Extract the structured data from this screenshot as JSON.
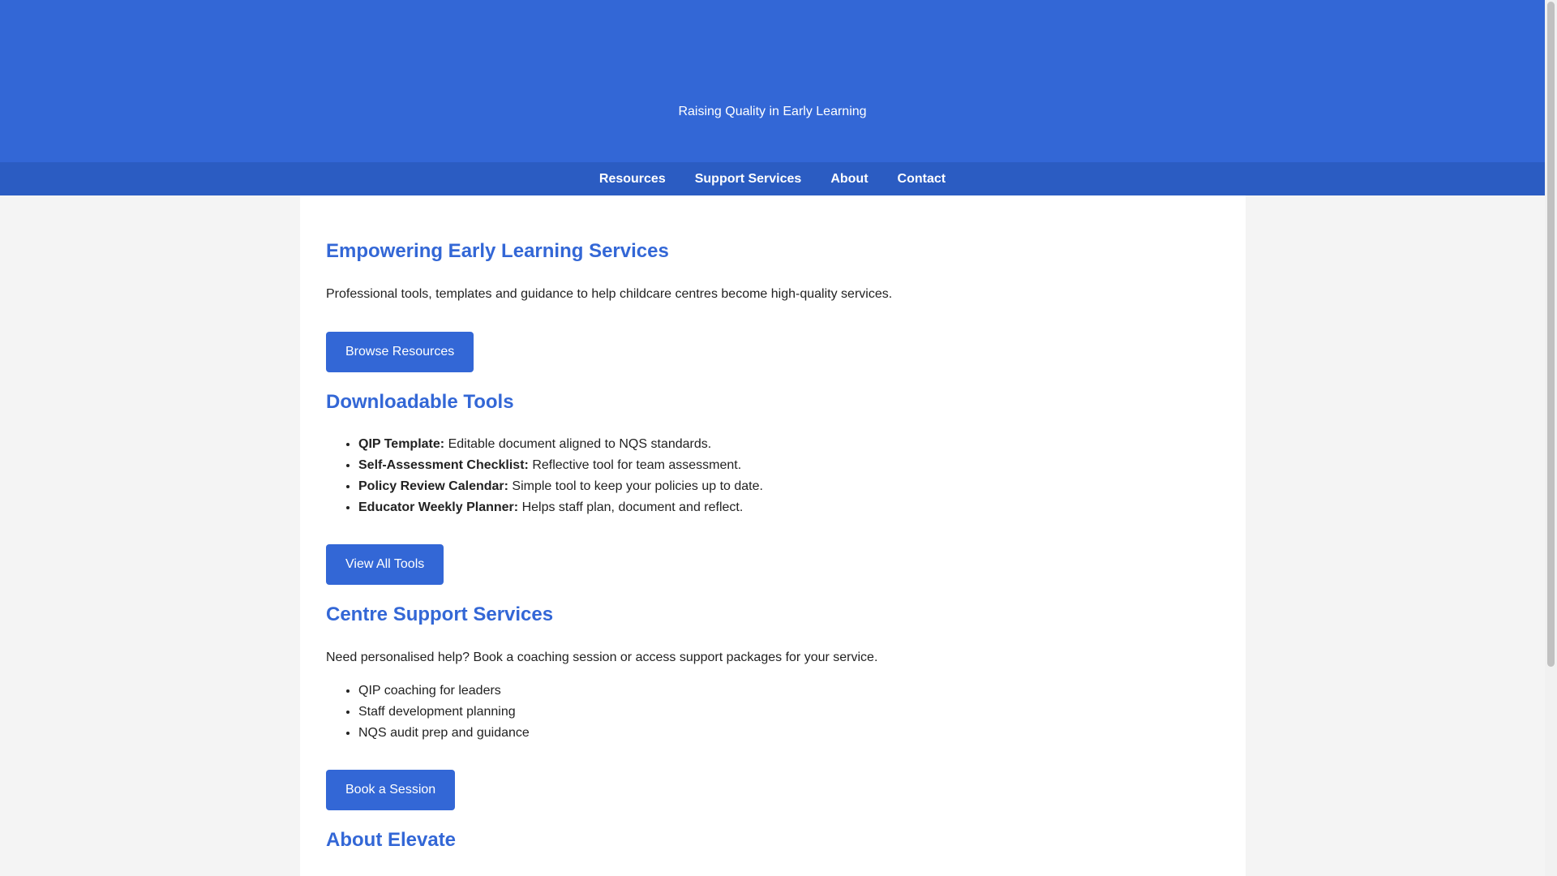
{
  "hero": {
    "tagline": "Raising Quality in Early Learning"
  },
  "nav": {
    "items": [
      "Resources",
      "Support Services",
      "About",
      "Contact"
    ]
  },
  "sections": {
    "empowering": {
      "heading": "Empowering Early Learning Services",
      "text": "Professional tools, templates and guidance to help childcare centres become high-quality services.",
      "button": "Browse Resources"
    },
    "tools": {
      "heading": "Downloadable Tools",
      "items": [
        {
          "title": "QIP Template:",
          "desc": "Editable document aligned to NQS standards."
        },
        {
          "title": "Self-Assessment Checklist:",
          "desc": "Reflective tool for team assessment."
        },
        {
          "title": "Policy Review Calendar:",
          "desc": "Simple tool to keep your policies up to date."
        },
        {
          "title": "Educator Weekly Planner:",
          "desc": "Helps staff plan, document and reflect."
        }
      ],
      "button": "View All Tools"
    },
    "support": {
      "heading": "Centre Support Services",
      "text": "Need personalised help? Book a coaching session or access support packages for your service.",
      "items": [
        "QIP coaching for leaders",
        "Staff development planning",
        "NQS audit prep and guidance"
      ],
      "button": "Book a Session"
    },
    "about": {
      "heading": "About Elevate"
    }
  },
  "colors": {
    "primary": "#3367d6",
    "nav": "#2b5cc2"
  }
}
